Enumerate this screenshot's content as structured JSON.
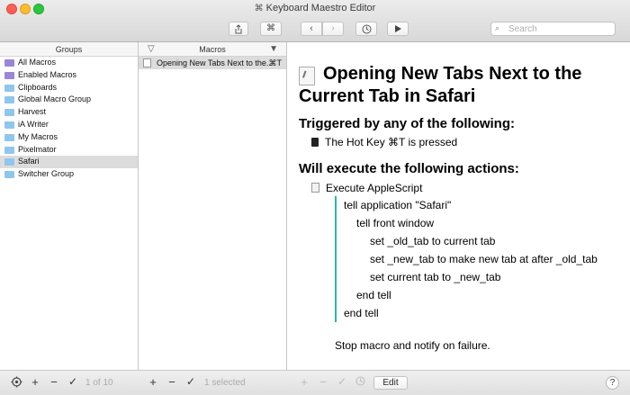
{
  "window": {
    "title": "Keyboard Maestro Editor",
    "title_icon": "⌘"
  },
  "toolbar": {
    "share_icon": "share-icon",
    "cmd_label": "⌘",
    "back_label": "‹",
    "forward_label": "›",
    "history_icon": "clock-icon",
    "run_icon": "play-icon",
    "search_placeholder": "Search"
  },
  "groups": {
    "header": "Groups",
    "items": [
      {
        "label": "All Macros",
        "type": "smart"
      },
      {
        "label": "Enabled Macros",
        "type": "smart"
      },
      {
        "label": "Clipboards",
        "type": "folder"
      },
      {
        "label": "Global Macro Group",
        "type": "folder"
      },
      {
        "label": "Harvest",
        "type": "folder"
      },
      {
        "label": "iA Writer",
        "type": "folder"
      },
      {
        "label": "My Macros",
        "type": "folder"
      },
      {
        "label": "Pixelmator",
        "type": "folder"
      },
      {
        "label": "Safari",
        "type": "folder",
        "selected": true
      },
      {
        "label": "Switcher Group",
        "type": "folder"
      }
    ],
    "footer_count": "1 of 10"
  },
  "macros": {
    "header": "Macros",
    "items": [
      {
        "label": "Opening New Tabs Next to the...",
        "hotkey": "⌘T"
      }
    ],
    "footer_count": "1 selected"
  },
  "editor": {
    "title_line1": "Opening New Tabs Next to the",
    "title_line2": "Current Tab in Safari",
    "triggered_heading": "Triggered by any of the following:",
    "trigger": "The Hot Key ⌘T is pressed",
    "actions_heading": "Will execute the following actions:",
    "action_name": "Execute AppleScript",
    "script_lines": [
      "tell application \"Safari\"",
      "tell front window",
      "set _old_tab to current tab",
      "set _new_tab to make new tab at after _old_tab",
      "set current tab to _new_tab",
      "end tell",
      "end tell"
    ],
    "failure_note": "Stop macro and notify on failure."
  },
  "bottom": {
    "edit_label": "Edit",
    "help_label": "?"
  }
}
